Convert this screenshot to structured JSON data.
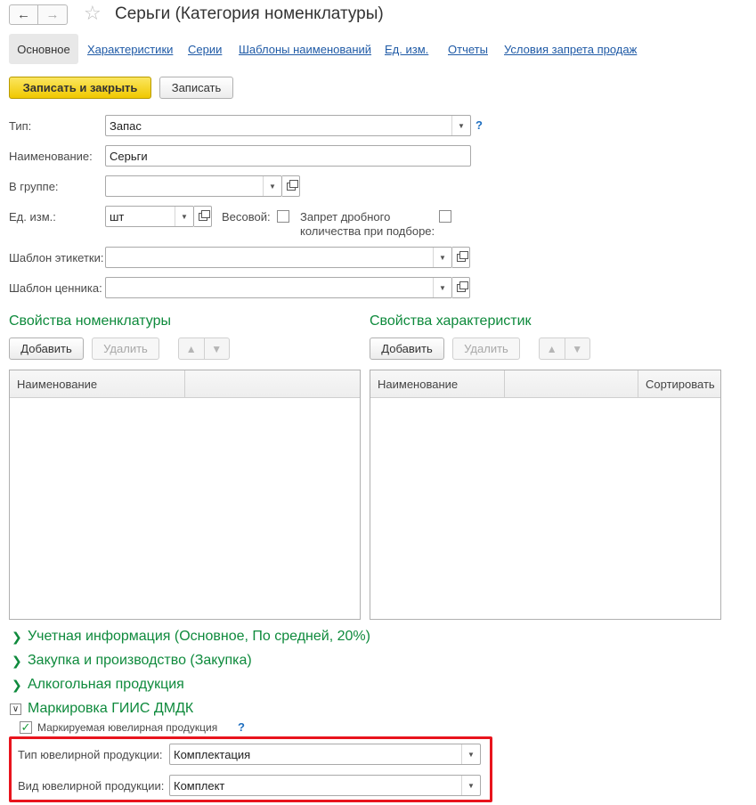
{
  "header": {
    "title": "Серьги (Категория номенклатуры)",
    "back_icon": "arrow-left-icon",
    "forward_icon": "arrow-right-icon",
    "favorite_icon": "star-icon"
  },
  "tabs": {
    "active": "Основное",
    "links": [
      "Характеристики",
      "Серии",
      "Шаблоны наименований",
      "Ед. изм.",
      "Отчеты",
      "Условия запрета продаж"
    ]
  },
  "toolbar": {
    "save_close": "Записать и закрыть",
    "save": "Записать"
  },
  "form": {
    "type_label": "Тип:",
    "type_value": "Запас",
    "help": "?",
    "name_label": "Наименование:",
    "name_value": "Серьги",
    "group_label": "В группе:",
    "group_value": "",
    "unit_label": "Ед. изм.:",
    "unit_value": "шт",
    "weight_label": "Весовой:",
    "fraction_label_1": "Запрет дробного",
    "fraction_label_2": "количества при подборе:",
    "label_template_label": "Шаблон этикетки:",
    "label_template_value": "",
    "price_template_label": "Шаблон ценника:",
    "price_template_value": ""
  },
  "properties_left": {
    "title": "Свойства номенклатуры",
    "add": "Добавить",
    "delete": "Удалить",
    "col_name": "Наименование"
  },
  "properties_right": {
    "title": "Свойства характеристик",
    "add": "Добавить",
    "delete": "Удалить",
    "col_name": "Наименование",
    "col_sort": "Сортировать"
  },
  "groups": {
    "accounting": "Учетная информация (Основное, По средней, 20%)",
    "purchase": "Закупка и производство (Закупка)",
    "alcohol": "Алкогольная продукция",
    "marking": "Маркировка ГИИС ДМДК"
  },
  "marking": {
    "jewelry_checkbox_label": "Маркируемая ювелирная продукция",
    "jewelry_checked": true,
    "help": "?",
    "jewelry_type_label": "Тип ювелирной продукции:",
    "jewelry_type_value": "Комплектация",
    "jewelry_kind_label": "Вид ювелирной продукции:",
    "jewelry_kind_value": "Комплект"
  },
  "colors": {
    "section_green": "#0e8a3c",
    "link_blue": "#1f5aa6",
    "primary_yellow": "#f5d200",
    "highlight_red": "#e8141d"
  }
}
